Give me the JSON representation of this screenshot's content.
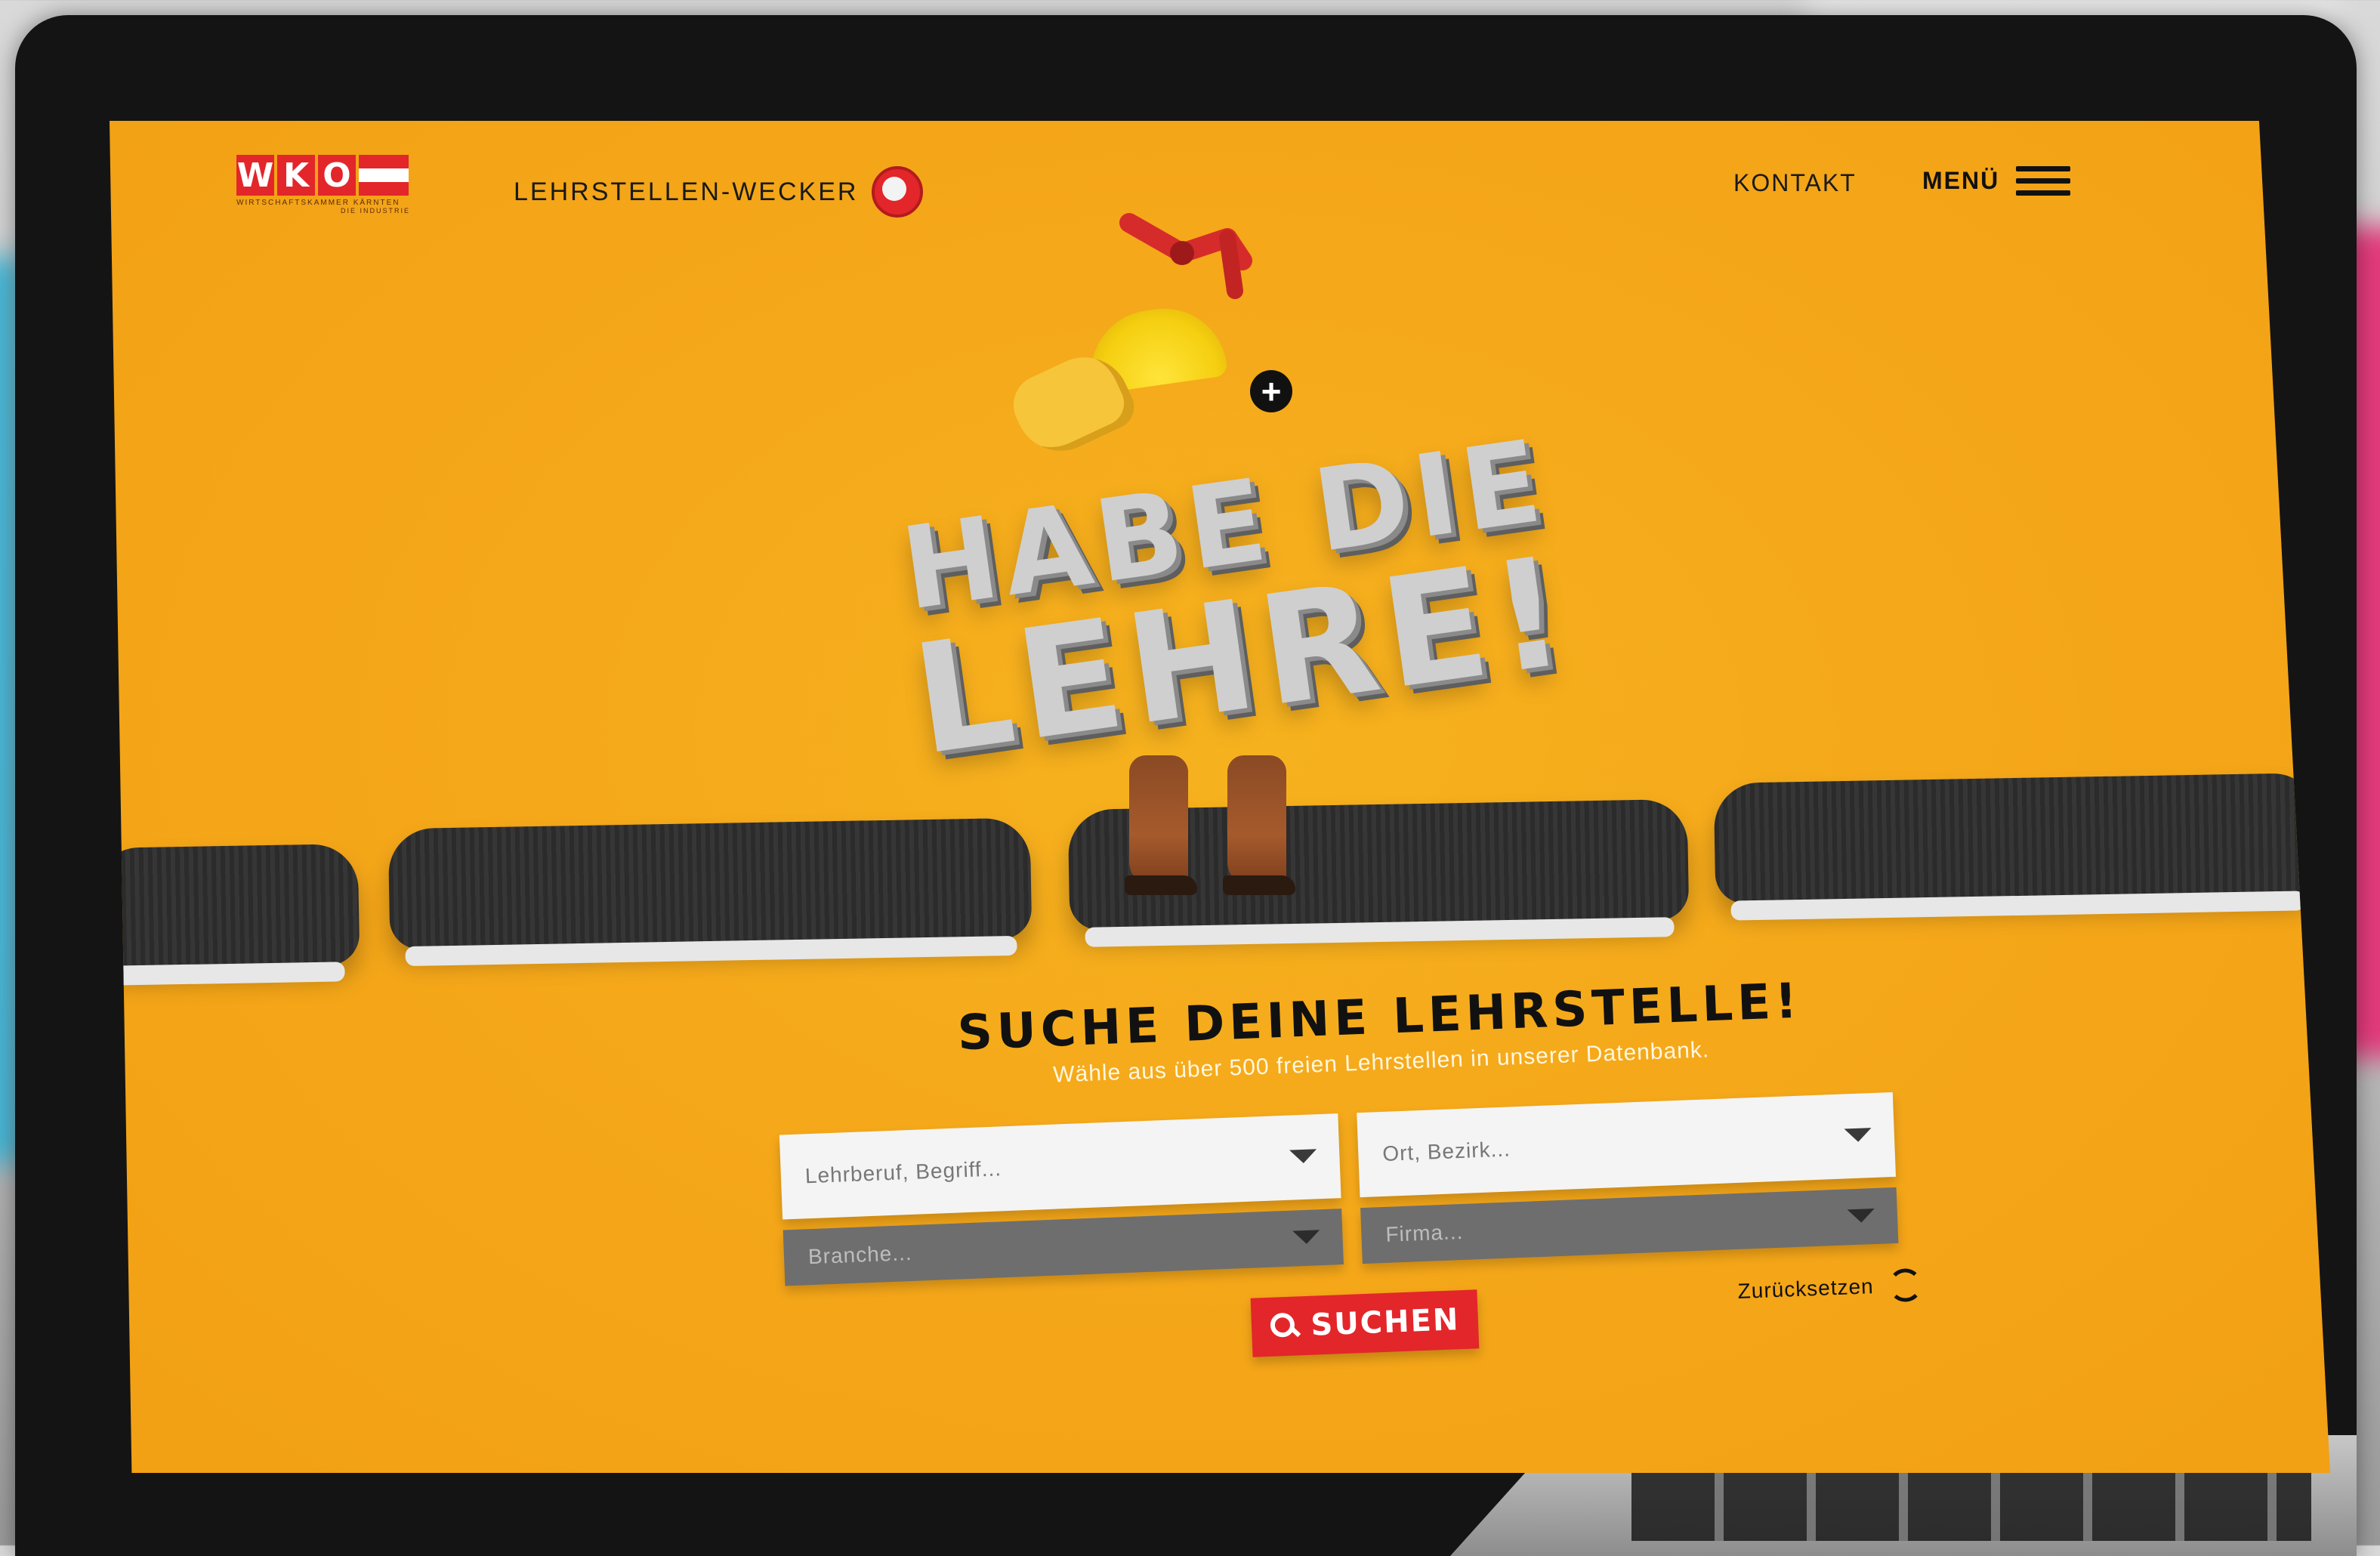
{
  "header": {
    "logo": {
      "letters": [
        "W",
        "K",
        "O"
      ],
      "subline": "WIRTSCHAFTSKAMMER KÄRNTEN",
      "subline2": "DIE INDUSTRIE",
      "flag_colors": [
        "#e3262a",
        "#ffffff",
        "#e3262a"
      ]
    },
    "brand_label": "LEHRSTELLEN-WECKER",
    "brand_icon": "alarm-clock-icon",
    "nav": {
      "kontakt": "KONTAKT",
      "menu_label": "MENÜ",
      "menu_icon": "hamburger-icon"
    }
  },
  "hero": {
    "title_line1": "HABE DIE",
    "title_line2": "LEHRE!",
    "plus_symbol": "+"
  },
  "search": {
    "title": "SUCHE DEINE LEHRSTELLE!",
    "subtitle": "Wähle aus über 500 freien Lehrstellen in unserer Datenbank.",
    "fields": [
      {
        "placeholder": "Lehrberuf, Begriff..."
      },
      {
        "placeholder": "Ort, Bezirk..."
      },
      {
        "placeholder": "Branche..."
      },
      {
        "placeholder": "Firma..."
      }
    ],
    "submit_label": "SUCHEN",
    "reset_label": "Zurücksetzen"
  },
  "colors": {
    "background": "#f5a81a",
    "accent_red": "#e3262a",
    "text_dark": "#111111"
  }
}
